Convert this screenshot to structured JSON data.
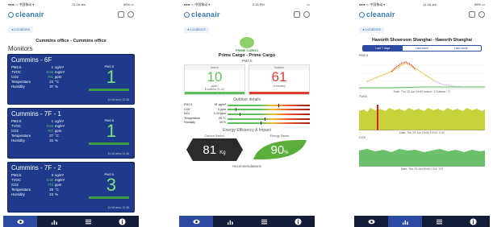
{
  "screen1": {
    "status": {
      "carrier": "●●●○○ 中国移动 ▾",
      "time": "11:16 am",
      "battery": "65% ▭"
    },
    "logo": "cleanair",
    "back_label": "◂  Locations",
    "location_title": "Cummins office - Cummins office",
    "section_title": "Monitors",
    "cards": [
      {
        "name": "Cummins - 6F",
        "pm_label": "PM2.5",
        "big": "1",
        "rows": [
          {
            "label": "PM2.5",
            "value": "1",
            "unit": "ug/m³",
            "green": false
          },
          {
            "label": "TVOC",
            "value": "0.04",
            "unit": "mg/m³",
            "green": true
          },
          {
            "label": "CO2",
            "value": "761",
            "unit": "ppm",
            "green": true
          },
          {
            "label": "Temperature",
            "value": "23",
            "unit": "°C",
            "green": false
          },
          {
            "label": "Humidity",
            "value": "37",
            "unit": "%",
            "green": false
          }
        ],
        "foot": "11:16 am ▸ 11:16"
      },
      {
        "name": "Cummins - 7F - 1",
        "pm_label": "PM2.5",
        "big": "1",
        "rows": [
          {
            "label": "PM2.5",
            "value": "1",
            "unit": "ug/m³",
            "green": false
          },
          {
            "label": "TVOC",
            "value": "0.04",
            "unit": "mg/m³",
            "green": true
          },
          {
            "label": "CO2",
            "value": "767",
            "unit": "ppm",
            "green": true
          },
          {
            "label": "Temperature",
            "value": "27",
            "unit": "°C",
            "green": false
          },
          {
            "label": "Humidity",
            "value": "34",
            "unit": "%",
            "green": false
          }
        ],
        "foot": "11:16 am ▸ 11:16"
      },
      {
        "name": "Cummins - 7F - 2",
        "pm_label": "PM2.5",
        "big": "3",
        "rows": [
          {
            "label": "PM2.5",
            "value": "3",
            "unit": "ug/m³",
            "green": false
          },
          {
            "label": "TVOC",
            "value": "0.02",
            "unit": "mg/m³",
            "green": true
          },
          {
            "label": "CO2",
            "value": "772",
            "unit": "ppm",
            "green": true
          },
          {
            "label": "Temperature",
            "value": "28",
            "unit": "°C",
            "green": false
          },
          {
            "label": "Humidity",
            "value": "23",
            "unit": "%",
            "green": false
          }
        ],
        "foot": "11:16 am ▸ 11:16"
      }
    ]
  },
  "screen2": {
    "status": {
      "carrier": "●●●○○ 中国移动 ▾",
      "time": "2:18 PM",
      "battery": "▭"
    },
    "logo": "cleanair",
    "back_label": "◂  Locations",
    "brand": "PRIME CARGO",
    "title": "Prime Cargo - Prime Cargo",
    "subtitle": "PM2.5",
    "indoor": {
      "header": "Indoor",
      "value": "10",
      "unit": "μg/m³",
      "note": "Excellent (0-12)"
    },
    "outdoor": {
      "header": "Outdoor",
      "value": "61",
      "unit": "Unhealthy",
      "note": ""
    },
    "outdoor_title": "Outdoor details",
    "outdoor_rows": [
      {
        "label": "PM2.5",
        "value": "61 μg/m³",
        "pos": 0.62
      },
      {
        "label": "CO2",
        "value": "5 ppm",
        "pos": 0.1
      },
      {
        "label": "NO2",
        "value": "0.04 ppm",
        "pos": 0.15
      },
      {
        "label": "Temperature",
        "value": "25 °C",
        "pos": 0.45
      },
      {
        "label": "Humidity",
        "value": "49 %",
        "pos": 0.4
      }
    ],
    "ee_title": "Energy Efficiency & Impact",
    "ee_left": {
      "caption": "Carbon Saved",
      "value": "81",
      "unit": "Kg"
    },
    "ee_right": {
      "caption": "Energy Saved",
      "value": "90",
      "unit": "%"
    },
    "recommendations": "recommendations"
  },
  "screen3": {
    "status": {
      "carrier": "●●●○○ 中国移动 ▾",
      "time": "11:16 am",
      "battery": "65% ▭"
    },
    "logo": "cleanair",
    "back_label": "◂  Locations",
    "title": "Haworth Showroom Shanghai - Haworth Shanghai",
    "segments": [
      "Last 7 days",
      "Last week",
      "Last month"
    ],
    "pm_chart": {
      "label": "PM2.5",
      "foot": "Date: Thu 25 Jun 19:00   Indoor: 3   Outdoor: 77"
    },
    "tvoc_chart": {
      "label": "TVOC",
      "foot": "Date: Thu 25 Jun 19:00   TVOC: 0.49"
    },
    "co2_chart": {
      "label": "CO2",
      "foot": "Date: Thu 25 Jun 19:00   CO2: 737"
    }
  },
  "colors": {
    "card": "#1f3a8a",
    "tabbar": "#131d3a",
    "tab_active": "#2d4aa3",
    "good": "#5cbf5c",
    "bad": "#e03c31"
  },
  "tabs": [
    "eye-icon",
    "chart-icon",
    "list-icon",
    "info-icon"
  ]
}
